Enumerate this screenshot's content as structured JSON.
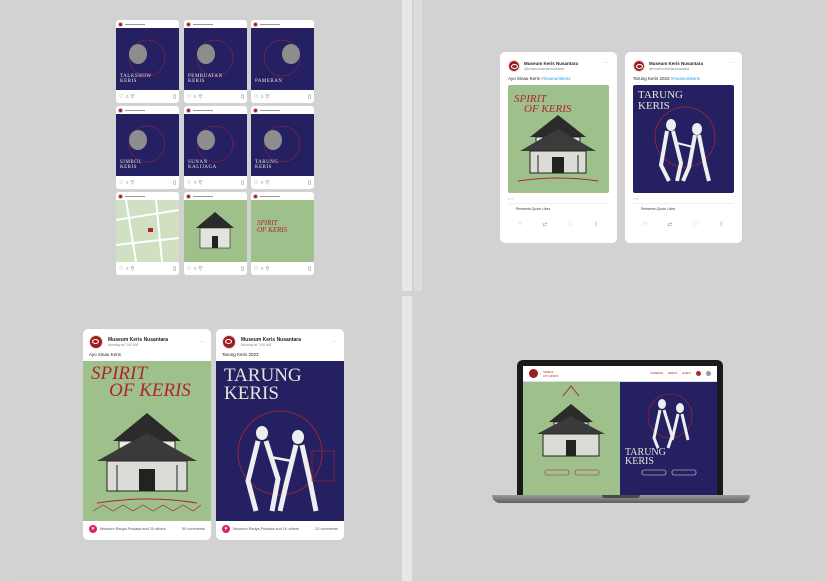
{
  "brand": {
    "account_name": "Museum Keris Nusantara",
    "navy": "#252062",
    "green": "#9ec08a",
    "red": "#b1252b"
  },
  "instagram_grid": {
    "posts": [
      {
        "bg": "navy",
        "lines": [
          "TALKSHOW",
          "KERIS"
        ]
      },
      {
        "bg": "navy",
        "lines": [
          "PEMBUATAN",
          "KERIS"
        ]
      },
      {
        "bg": "navy",
        "lines": [
          "PAMERAN"
        ]
      },
      {
        "bg": "navy",
        "lines": [
          "SIMBOL",
          "KERIS"
        ]
      },
      {
        "bg": "navy",
        "lines": [
          "SUNAN",
          "KALIJAGA"
        ]
      },
      {
        "bg": "navy",
        "lines": [
          "TARUNG",
          "KERIS"
        ]
      },
      {
        "bg": "map",
        "lines": []
      },
      {
        "bg": "green",
        "lines": []
      },
      {
        "bg": "green",
        "lines": [
          "SPIRIT",
          "OF KERIS"
        ]
      }
    ],
    "icons": [
      "heart-icon",
      "comment-icon",
      "share-icon",
      "bookmark-icon"
    ]
  },
  "twitter": [
    {
      "name": "Museum Keris Nusantara",
      "handle": "@museumkerisnusantara",
      "text": "Ayo Sinau Keris",
      "hashtag": "#museumkeris",
      "poster_title": [
        "SPIRIT",
        "OF KERIS"
      ],
      "bg": "green",
      "stats": "Retweets   Quote   Likes"
    },
    {
      "name": "Museum Keris Nusantara",
      "handle": "@museumkerisnusantara",
      "text": "Tarung Keris 2023",
      "hashtag": "#museumkeris",
      "poster_title": [
        "TARUNG",
        "KERIS"
      ],
      "bg": "navy",
      "stats": "Retweets   Quote   Likes"
    }
  ],
  "facebook": [
    {
      "name": "Museum Keris Nusantara",
      "time": "Monday at 7:00 AM",
      "text": "Ayo Sinau Keris",
      "poster_title": [
        "SPIRIT",
        "OF KERIS"
      ],
      "bg": "green",
      "reactions": "Museum Radya Pustaka and 20 others",
      "comments": "50 comments"
    },
    {
      "name": "Museum Keris Nusantara",
      "time": "Monday at 7:00 AM",
      "text": "Tarung Keris 2023",
      "poster_title": [
        "TARUNG",
        "KERIS"
      ],
      "bg": "navy",
      "reactions": "Museum Radya Pustaka and 1K others",
      "comments": "22 comments"
    }
  ],
  "website": {
    "title": [
      "SPIRIT",
      "OF KERIS"
    ],
    "nav_links": [
      "PAMERAN",
      "BERITA",
      "EVENT"
    ],
    "left_title": [
      "SPIRIT",
      "OF KERIS"
    ],
    "right_title": [
      "TARUNG",
      "KERIS"
    ]
  }
}
